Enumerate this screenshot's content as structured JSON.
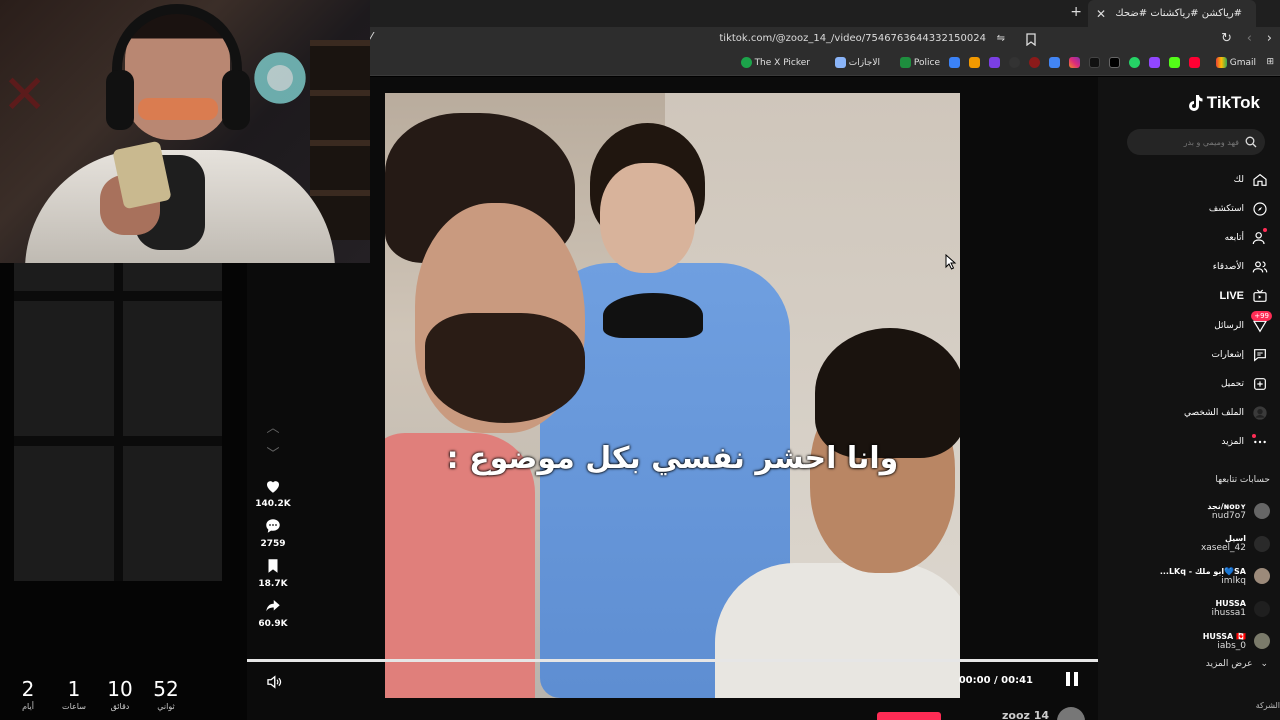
{
  "stream": {
    "countdown": [
      {
        "value": "2",
        "label": "أيام"
      },
      {
        "value": "1",
        "label": "ساعات"
      },
      {
        "value": "10",
        "label": "دقائق"
      },
      {
        "value": "52",
        "label": "ثواني"
      }
    ]
  },
  "browser": {
    "tab_title": "#رياكشن #رياكشنات #ضحك | ...",
    "url": "tiktok.com/@zooz_14_/video/7546763644332150024",
    "bookmarks": [
      "Gmail",
      "Police",
      "الاجازات",
      "The X Picker"
    ]
  },
  "video": {
    "caption": "وانا احشر نفسي بكل موضوع :",
    "time": "00:00 / 00:41",
    "progress": 1.0,
    "bottom_handle": "zooz 14"
  },
  "actions": [
    {
      "icon": "heart-icon",
      "count": "140.2K"
    },
    {
      "icon": "comment-icon",
      "count": "2759"
    },
    {
      "icon": "bookmark-icon",
      "count": "18.7K"
    },
    {
      "icon": "share-icon",
      "count": "60.9K"
    }
  ],
  "sidebar": {
    "logo": "TikTok",
    "search_placeholder": "فهد وميمي و بدر",
    "nav": [
      {
        "key": "foryou",
        "label": "لك"
      },
      {
        "key": "explore",
        "label": "استكشف"
      },
      {
        "key": "following",
        "label": "أتابعه"
      },
      {
        "key": "friends",
        "label": "الأصدقاء"
      },
      {
        "key": "live",
        "label": "LIVE"
      },
      {
        "key": "messages",
        "label": "الرسائل",
        "badge": "99+"
      },
      {
        "key": "activity",
        "label": "إشعارات"
      },
      {
        "key": "upload",
        "label": "تحميل"
      },
      {
        "key": "profile",
        "label": "الملف الشخصي"
      },
      {
        "key": "more",
        "label": "المزيد"
      }
    ],
    "following_title": "حسابات تتابعها",
    "accounts": [
      {
        "name": "ɴᴏᴅʏ/نجد",
        "handle": "nud7o7"
      },
      {
        "name": "اسيل",
        "handle": "xaseel_42"
      },
      {
        "name": "SA💙ابو ملك - LKq...",
        "handle": "imlkq"
      },
      {
        "name": "HUSSA",
        "handle": "ihussa1"
      },
      {
        "name": "HUSSA 🇨🇦",
        "handle": "iabs_0"
      }
    ],
    "see_more": "عرض المزيد",
    "company": "الشركة"
  },
  "colors": {
    "accent": "#fe2c55",
    "sidebar_bg": "#121212"
  }
}
